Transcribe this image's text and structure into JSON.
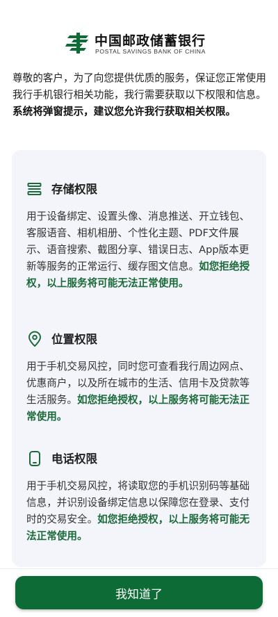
{
  "brand": {
    "name_cn": "中国邮政储蓄银行",
    "name_en": "POSTAL SAVINGS BANK OF CHINA",
    "logo_icon": "postal-logo-icon",
    "color": "#0d6b35"
  },
  "intro": {
    "text": "尊敬的客户，为了向您提供优质的服务，保证您正常使用我行手机银行相关功能，我行需要获取以下权限和信息。",
    "bold": "系统将弹窗提示，建议您允许我行获取相关权限。"
  },
  "permissions": [
    {
      "icon": "storage-icon",
      "title": "存储权限",
      "desc": "用于设备绑定、设置头像、消息推送、开立钱包、客服语音、相机相册、个性化主题、PDF文件展示、语音搜索、截图分享、错误日志、App版本更新等服务的正常运行、缓存图文信息。",
      "warning": "如您拒绝授权，以上服务将可能无法正常使用。"
    },
    {
      "icon": "location-icon",
      "title": "位置权限",
      "desc": "用于手机交易风控，同时您可查看我行周边网点、优惠商户，以及所在城市的生活、信用卡及贷款等生活服务。",
      "warning": "如您拒绝授权，以上服务将可能无法正常使用。"
    },
    {
      "icon": "phone-icon",
      "title": "电话权限",
      "desc": "用于手机交易风控，将读取您的手机识别码等基础信息，并识别设备绑定信息以保障您在登录、支付时的交易安全。",
      "warning": "如您拒绝授权，以上服务将可能无法正常使用。"
    }
  ],
  "confirm_label": "我知道了",
  "accent_color": "#1b6b3a"
}
